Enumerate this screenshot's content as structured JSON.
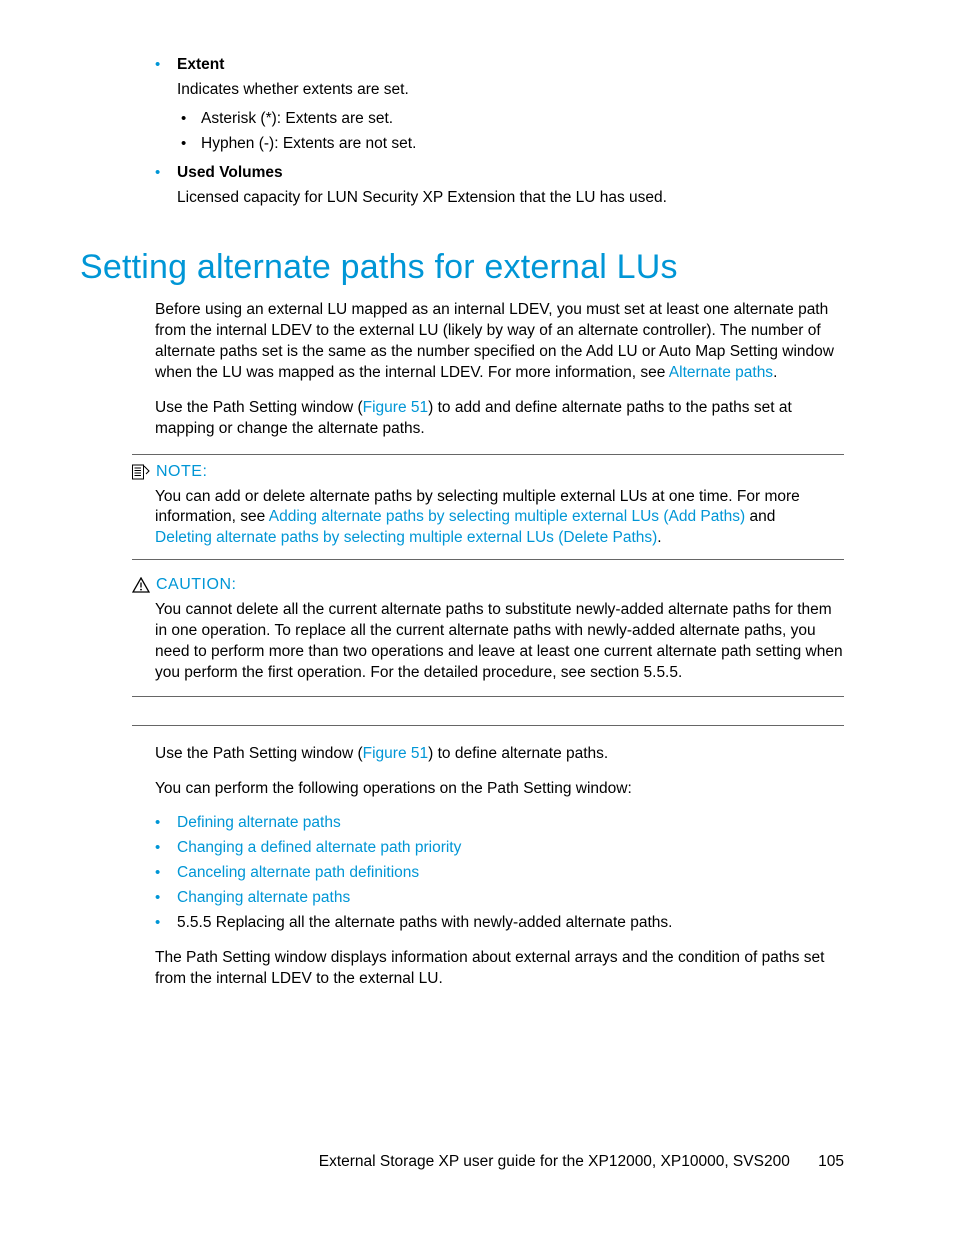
{
  "top_bullets": {
    "extent": {
      "title": "Extent",
      "desc": "Indicates whether extents are set.",
      "sub1": "Asterisk (*): Extents are set.",
      "sub2": "Hyphen (-): Extents are not set."
    },
    "used_volumes": {
      "title": "Used Volumes",
      "desc": "Licensed capacity for LUN Security XP Extension that the LU has used."
    }
  },
  "heading": "Setting alternate paths for external LUs",
  "para1_a": "Before using an external LU mapped as an internal LDEV, you must set at least one alternate path from the internal LDEV to the external LU (likely by way of an alternate controller). The number of alternate paths set is the same as the number specified on the Add LU or Auto Map Setting window when the LU was mapped as the internal LDEV. For more information, see ",
  "para1_link": "Alternate paths",
  "para1_b": ".",
  "para2_a": "Use the Path Setting window (",
  "para2_link": "Figure 51",
  "para2_b": ") to add and define alternate paths to the paths set at mapping or change the alternate paths.",
  "note": {
    "label": "NOTE:",
    "body_a": "You can add or delete alternate paths by selecting multiple external LUs at one time. For more information, see ",
    "link1": "Adding alternate paths by selecting multiple external LUs (Add Paths)",
    "body_b": " and ",
    "link2": "Deleting alternate paths by selecting multiple external LUs (Delete Paths)",
    "body_c": "."
  },
  "caution": {
    "label": "CAUTION:",
    "body": "You cannot delete all the current alternate paths to substitute newly-added alternate paths for them in one operation. To replace all the current alternate paths with newly-added alternate paths, you need to perform more than two operations and leave at least one current alternate path setting when you perform the first operation. For the detailed procedure, see section 5.5.5."
  },
  "para3_a": "Use the Path Setting window (",
  "para3_link": "Figure 51",
  "para3_b": ") to define alternate paths.",
  "para4": "You can perform the following operations on the Path Setting window:",
  "ops": {
    "op1": "Defining alternate paths",
    "op2": "Changing a defined alternate path priority",
    "op3": "Canceling alternate path definitions",
    "op4": "Changing alternate paths",
    "op5": "5.5.5 Replacing all the alternate paths with newly-added alternate paths."
  },
  "para5": "The Path Setting window displays information about external arrays and the condition of paths set from the internal LDEV to the external LU.",
  "footer_text": "External Storage XP user guide for the XP12000, XP10000, SVS200",
  "page_number": "105"
}
